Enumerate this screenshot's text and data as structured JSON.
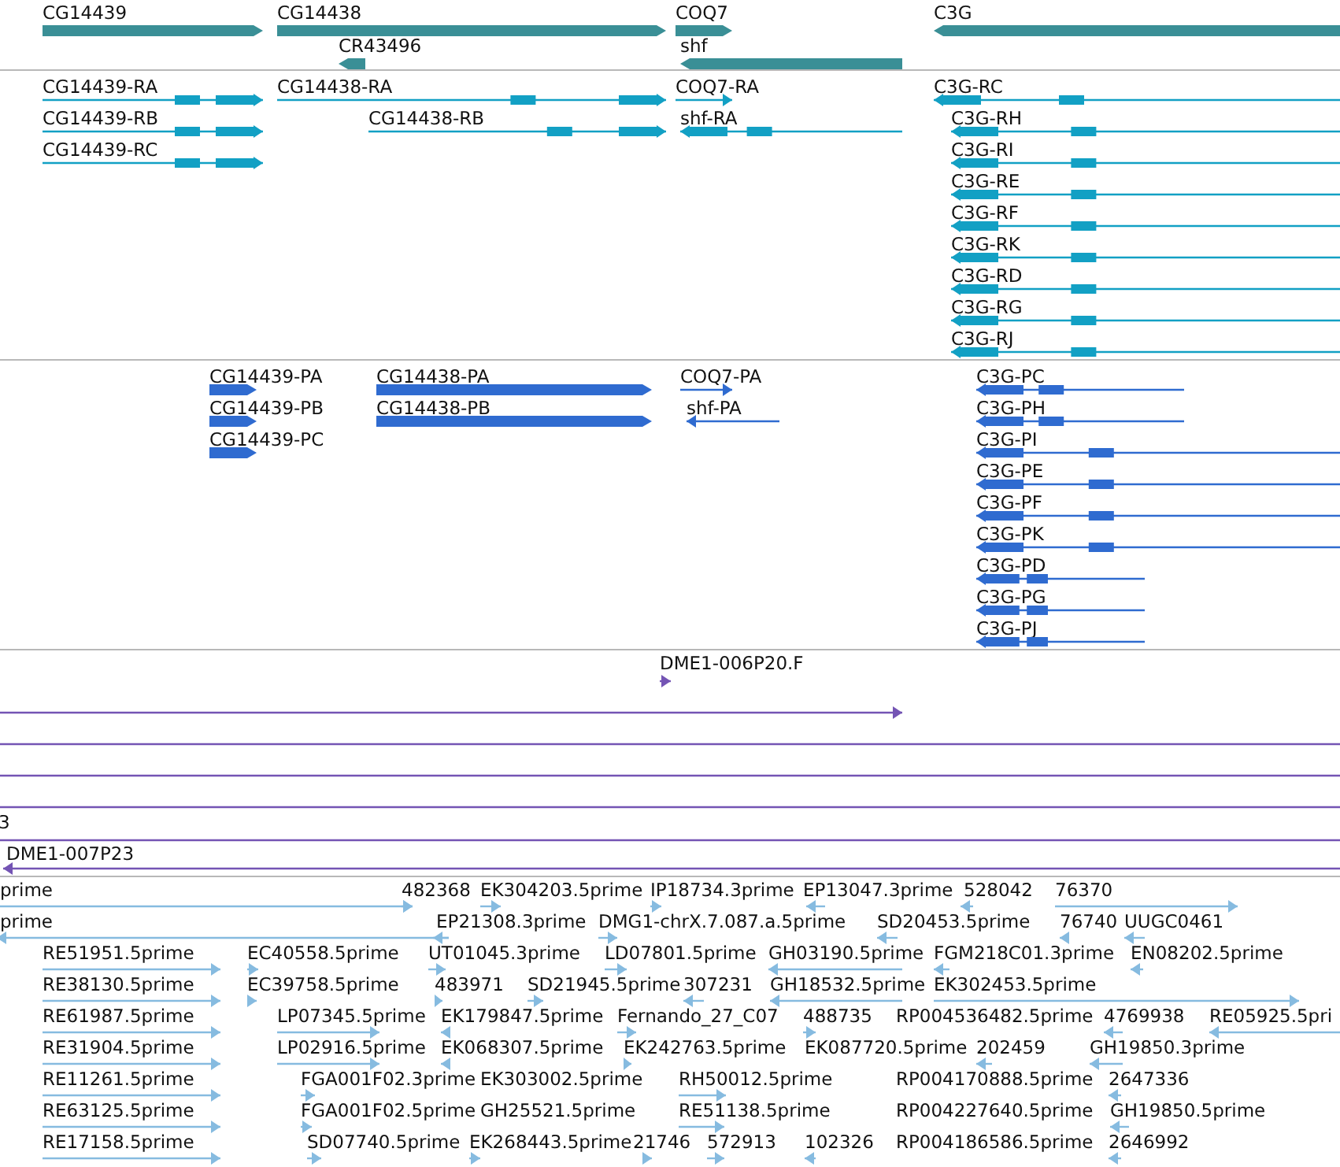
{
  "tracks": [
    {
      "kind": "gene",
      "color": "#3a8f96",
      "features": [
        {
          "label": "CG14439",
          "reverse": false
        },
        {
          "label": "CG14438",
          "reverse": false
        },
        {
          "label": "CR43496",
          "reverse": true
        },
        {
          "label": "COQ7",
          "reverse": false
        },
        {
          "label": "shf",
          "reverse": true
        },
        {
          "label": "C3G",
          "reverse": true
        }
      ]
    },
    {
      "kind": "transcript",
      "color": "#12a0c4",
      "features": [
        {
          "label": "CG14439-RA",
          "reverse": false
        },
        {
          "label": "CG14439-RB",
          "reverse": false
        },
        {
          "label": "CG14439-RC",
          "reverse": false
        },
        {
          "label": "CG14438-RA",
          "reverse": false
        },
        {
          "label": "CG14438-RB",
          "reverse": false
        },
        {
          "label": "COQ7-RA",
          "reverse": false
        },
        {
          "label": "shf-RA",
          "reverse": true
        },
        {
          "label": "C3G-RC",
          "reverse": true
        },
        {
          "label": "C3G-RH",
          "reverse": true
        },
        {
          "label": "C3G-RI",
          "reverse": true
        },
        {
          "label": "C3G-RE",
          "reverse": true
        },
        {
          "label": "C3G-RF",
          "reverse": true
        },
        {
          "label": "C3G-RK",
          "reverse": true
        },
        {
          "label": "C3G-RD",
          "reverse": true
        },
        {
          "label": "C3G-RG",
          "reverse": true
        },
        {
          "label": "C3G-RJ",
          "reverse": true
        }
      ]
    },
    {
      "kind": "protein",
      "color": "#2f6bd0",
      "features": [
        {
          "label": "CG14439-PA",
          "reverse": false
        },
        {
          "label": "CG14439-PB",
          "reverse": false
        },
        {
          "label": "CG14439-PC",
          "reverse": false
        },
        {
          "label": "CG14438-PA",
          "reverse": false
        },
        {
          "label": "CG14438-PB",
          "reverse": false
        },
        {
          "label": "COQ7-PA",
          "reverse": false
        },
        {
          "label": "shf-PA",
          "reverse": true
        },
        {
          "label": "C3G-PC",
          "reverse": true
        },
        {
          "label": "C3G-PH",
          "reverse": true
        },
        {
          "label": "C3G-PI",
          "reverse": true
        },
        {
          "label": "C3G-PE",
          "reverse": true
        },
        {
          "label": "C3G-PF",
          "reverse": true
        },
        {
          "label": "C3G-PK",
          "reverse": true
        },
        {
          "label": "C3G-PD",
          "reverse": true
        },
        {
          "label": "C3G-PG",
          "reverse": true
        },
        {
          "label": "C3G-PJ",
          "reverse": true
        }
      ]
    },
    {
      "kind": "alignment",
      "color": "#7454b4",
      "features": [
        {
          "label": "DME1-006P20.F",
          "reverse": false
        },
        {
          "reverse": false
        },
        {
          "label": "3"
        },
        {
          "label": "DME1-007P23",
          "reverse": true
        }
      ]
    },
    {
      "kind": "est",
      "color": "#86bbe0",
      "features": [
        {
          "label": "prime",
          "reverse": false
        },
        {
          "label": "482368",
          "reverse": false
        },
        {
          "label": "EK304203.5prime",
          "reverse": false
        },
        {
          "label": "IP18734.3prime",
          "reverse": false
        },
        {
          "label": "EP13047.3prime",
          "reverse": true
        },
        {
          "label": "528042",
          "reverse": true
        },
        {
          "label": "76370",
          "reverse": false
        },
        {
          "label": "prime",
          "reverse": true
        },
        {
          "label": "EP21308.3prime",
          "reverse": true
        },
        {
          "label": "DMG1-chrX.7.087.a.5prime",
          "reverse": false
        },
        {
          "label": "SD20453.5prime",
          "reverse": true
        },
        {
          "label": "76740",
          "reverse": true
        },
        {
          "label": "UUGC0461",
          "reverse": true
        },
        {
          "label": "RE51951.5prime",
          "reverse": false
        },
        {
          "label": "EC40558.5prime",
          "reverse": false
        },
        {
          "label": "UT01045.3prime",
          "reverse": false
        },
        {
          "label": "LD07801.5prime",
          "reverse": false
        },
        {
          "label": "GH03190.5prime",
          "reverse": true
        },
        {
          "label": "FGM218C01.3prime",
          "reverse": true
        },
        {
          "label": "EN08202.5prime",
          "reverse": true
        },
        {
          "label": "RE38130.5prime",
          "reverse": false
        },
        {
          "label": "EC39758.5prime",
          "reverse": false
        },
        {
          "label": "483971",
          "reverse": false
        },
        {
          "label": "SD21945.5prime",
          "reverse": false
        },
        {
          "label": "307231",
          "reverse": true
        },
        {
          "label": "GH18532.5prime",
          "reverse": true
        },
        {
          "label": "EK302453.5prime",
          "reverse": false
        },
        {
          "label": "RE61987.5prime",
          "reverse": false
        },
        {
          "label": "LP07345.5prime",
          "reverse": false
        },
        {
          "label": "EK179847.5prime",
          "reverse": true
        },
        {
          "label": "Fernando_27_C07",
          "reverse": false
        },
        {
          "label": "488735",
          "reverse": false
        },
        {
          "label": "RP004536482.5prime"
        },
        {
          "label": "4769938",
          "reverse": true
        },
        {
          "label": "RE05925.5pri",
          "reverse": true
        },
        {
          "label": "RE31904.5prime",
          "reverse": false
        },
        {
          "label": "LP02916.5prime",
          "reverse": false
        },
        {
          "label": "EK068307.5prime",
          "reverse": true
        },
        {
          "label": "EK242763.5prime",
          "reverse": false
        },
        {
          "label": "EK087720.5prime"
        },
        {
          "label": "202459",
          "reverse": true
        },
        {
          "label": "GH19850.3prime",
          "reverse": true
        },
        {
          "label": "RE11261.5prime",
          "reverse": false
        },
        {
          "label": "FGA001F02.3prime",
          "reverse": false
        },
        {
          "label": "EK303002.5prime"
        },
        {
          "label": "RH50012.5prime",
          "reverse": false
        },
        {
          "label": "RP004170888.5prime"
        },
        {
          "label": "2647336",
          "reverse": true
        },
        {
          "label": "RE63125.5prime",
          "reverse": false
        },
        {
          "label": "FGA001F02.5prime",
          "reverse": false
        },
        {
          "label": "GH25521.5prime"
        },
        {
          "label": "RE51138.5prime",
          "reverse": false
        },
        {
          "label": "RP004227640.5prime"
        },
        {
          "label": "GH19850.5prime",
          "reverse": true
        },
        {
          "label": "RE17158.5prime",
          "reverse": false
        },
        {
          "label": "SD07740.5prime",
          "reverse": false
        },
        {
          "label": "EK268443.5prime",
          "reverse": false
        },
        {
          "label": "21746",
          "reverse": false
        },
        {
          "label": "572913",
          "reverse": false
        },
        {
          "label": "102326",
          "reverse": true
        },
        {
          "label": "RP004186586.5prime"
        },
        {
          "label": "2646992",
          "reverse": true
        }
      ]
    }
  ]
}
